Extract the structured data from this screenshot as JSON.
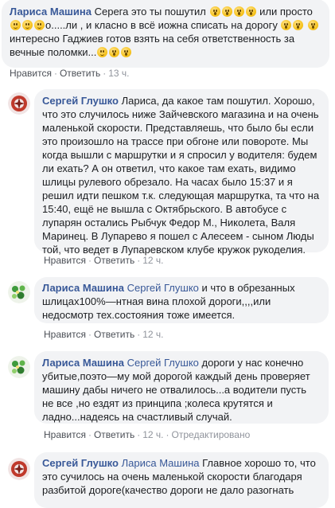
{
  "comments": [
    {
      "author": "Лариса Машина",
      "text_a": "Серега это ты пошутил",
      "text_b": "или просто",
      "text_c": "о.....ли , и класно в всё иожна списать на дорогу",
      "text_d": "интересно Гаджиев готов взять на себя ответственность за вечные поломки...",
      "emojis": [
        "face-icon",
        "face-icon",
        "face-icon",
        "face-icon",
        "face-icon",
        "face-icon",
        "face-icon",
        "face-icon",
        "face-icon",
        "face-icon",
        "face-icon",
        "face-icon"
      ],
      "like": "Нравится",
      "reply": "Ответить",
      "time": "13 ч."
    },
    {
      "author": "Сергей Глушко",
      "text": "Лариса, да какое там пошутил. Хорошо, что это случилось ниже Зайчевского магазина и на очень маленькой скорости. Представляешь, что было бы если это произошло на трассе при обгоне или повороте. Мы когда вышли с маршрутки и я спросил у водителя: будем ли ехать? А он ответил, что какое там ехать, видимо шлицы рулевого обрезало. На часах было 15:37 и я решил идти пешком т.к. следующая маршрутка, та что на 15:40, ещё не вышла с Октябрьского. В автобусе с лупарян остались Рыбчук Федор М., Николета, Валя Маринец. В Лупарево я пошел с Алесеем - сыном Люды той, что ведет в Лупаревском клубе кружок рукоделия.",
      "like": "Нравится",
      "reply": "Ответить",
      "time": "12 ч."
    },
    {
      "author": "Лариса Машина",
      "mention": "Сергей Глушко",
      "text": "и что в обрезанных шлицах100%—нтная вина плохой дороги,,,,или недосмотр тех.состояния тоже имеется.",
      "like": "Нравится",
      "reply": "Ответить",
      "time": "12 ч."
    },
    {
      "author": "Лариса Машина",
      "mention": "Сергей Глушко",
      "text": "дороги у нас конечно убитые,поэто—му мой дорогой каждый день проверяет машину дабы ничего не отвалилось...а водители пусть не все ,но ездят из принципа ;колеса крутятся и ладно...надеясь на счастливый случай.",
      "like": "Нравится",
      "reply": "Ответить",
      "time": "12 ч.",
      "edited": "Отредактировано"
    },
    {
      "author": "Сергей Глушко",
      "mention": "Лариса Машина",
      "text": "Главное хорошо то, что это сучилось на очень маленькой скорости благодаря разбитой дороге(качество дороги не дало разогнать"
    }
  ],
  "colors": {
    "link": "#385898",
    "bubble": "#f2f3f5",
    "meta": "#90949c"
  }
}
